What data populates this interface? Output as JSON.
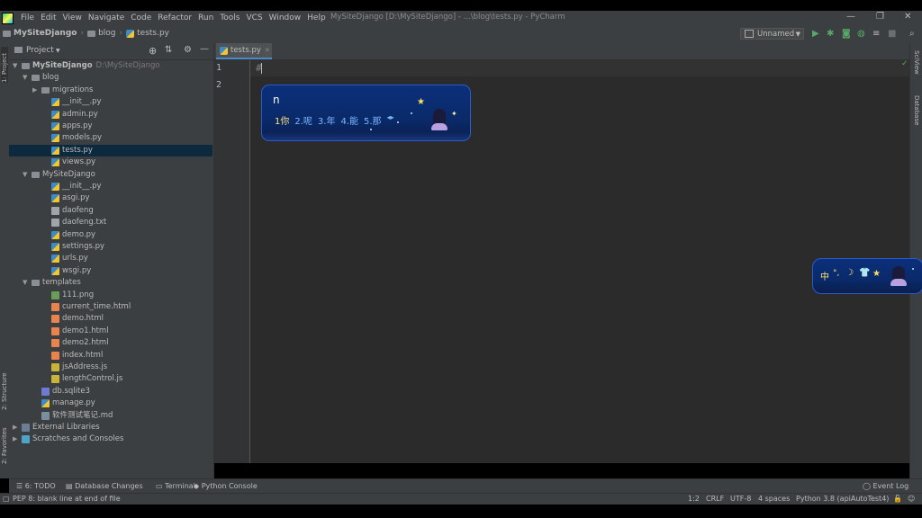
{
  "menu": {
    "items": [
      "File",
      "Edit",
      "View",
      "Navigate",
      "Code",
      "Refactor",
      "Run",
      "Tools",
      "VCS",
      "Window",
      "Help"
    ],
    "title": "MySiteDjango [D:\\MySiteDjango] - ...\\blog\\tests.py - PyCharm"
  },
  "nav": {
    "crumbs": [
      "MySiteDjango",
      "blog",
      "tests.py"
    ],
    "run_config": "Unnamed"
  },
  "project": {
    "header": "Project",
    "tree": [
      {
        "label": "MySiteDjango",
        "extra": "D:\\MySiteDjango",
        "icon": "folder",
        "arrow": "▼",
        "indent": 0,
        "bold": true
      },
      {
        "label": "blog",
        "icon": "folder",
        "arrow": "▼",
        "indent": 1
      },
      {
        "label": "migrations",
        "icon": "folder",
        "arrow": "▶",
        "indent": 2
      },
      {
        "label": "__init__.py",
        "icon": "py",
        "arrow": "",
        "indent": 3
      },
      {
        "label": "admin.py",
        "icon": "py",
        "arrow": "",
        "indent": 3
      },
      {
        "label": "apps.py",
        "icon": "py",
        "arrow": "",
        "indent": 3
      },
      {
        "label": "models.py",
        "icon": "py",
        "arrow": "",
        "indent": 3
      },
      {
        "label": "tests.py",
        "icon": "py",
        "arrow": "",
        "indent": 3,
        "selected": true
      },
      {
        "label": "views.py",
        "icon": "py",
        "arrow": "",
        "indent": 3
      },
      {
        "label": "MySiteDjango",
        "icon": "folder",
        "arrow": "▼",
        "indent": 1
      },
      {
        "label": "__init__.py",
        "icon": "py",
        "arrow": "",
        "indent": 3
      },
      {
        "label": "asgi.py",
        "icon": "py",
        "arrow": "",
        "indent": 3
      },
      {
        "label": "daofeng",
        "icon": "txt",
        "arrow": "",
        "indent": 3
      },
      {
        "label": "daofeng.txt",
        "icon": "txt",
        "arrow": "",
        "indent": 3
      },
      {
        "label": "demo.py",
        "icon": "py",
        "arrow": "",
        "indent": 3
      },
      {
        "label": "settings.py",
        "icon": "py",
        "arrow": "",
        "indent": 3
      },
      {
        "label": "urls.py",
        "icon": "py",
        "arrow": "",
        "indent": 3
      },
      {
        "label": "wsgi.py",
        "icon": "py",
        "arrow": "",
        "indent": 3
      },
      {
        "label": "templates",
        "icon": "folder",
        "arrow": "▼",
        "indent": 1
      },
      {
        "label": "111.png",
        "icon": "png",
        "arrow": "",
        "indent": 3
      },
      {
        "label": "current_time.html",
        "icon": "html",
        "arrow": "",
        "indent": 3
      },
      {
        "label": "demo.html",
        "icon": "html",
        "arrow": "",
        "indent": 3
      },
      {
        "label": "demo1.html",
        "icon": "html",
        "arrow": "",
        "indent": 3
      },
      {
        "label": "demo2.html",
        "icon": "html",
        "arrow": "",
        "indent": 3
      },
      {
        "label": "index.html",
        "icon": "html",
        "arrow": "",
        "indent": 3
      },
      {
        "label": "jsAddress.js",
        "icon": "js",
        "arrow": "",
        "indent": 3
      },
      {
        "label": "lengthControl.js",
        "icon": "js",
        "arrow": "",
        "indent": 3
      },
      {
        "label": "db.sqlite3",
        "icon": "db",
        "arrow": "",
        "indent": 2
      },
      {
        "label": "manage.py",
        "icon": "py",
        "arrow": "",
        "indent": 2
      },
      {
        "label": "软件测试笔记.md",
        "icon": "md",
        "arrow": "",
        "indent": 2
      },
      {
        "label": "External Libraries",
        "icon": "lib",
        "arrow": "▶",
        "indent": 0
      },
      {
        "label": "Scratches and Consoles",
        "icon": "scratch",
        "arrow": "▶",
        "indent": 0
      }
    ]
  },
  "editor": {
    "tab": "tests.py",
    "lines": [
      "1",
      "2"
    ],
    "code": "#"
  },
  "left_strip": {
    "project": "1: Project",
    "structure": "2: Structure",
    "favorites": "2: Favorites"
  },
  "right_strip": {
    "sciview": "SciView",
    "database": "Database"
  },
  "bottom_tools": {
    "todo": "6: TODO",
    "db_changes": "Database Changes",
    "terminal": "Terminal",
    "python_console": "Python Console",
    "event_log": "Event Log"
  },
  "status": {
    "message": "PEP 8: blank line at end of file",
    "position": "1:2",
    "line_sep": "CRLF",
    "encoding": "UTF-8",
    "indent": "4 spaces",
    "interpreter": "Python 3.8 (apiAutoTest4)"
  },
  "ime": {
    "input": "n",
    "candidates": [
      "1你",
      "2.呢",
      "3.年",
      "4.能",
      "5.那"
    ],
    "toolbar_label": "中"
  },
  "colors": {
    "bg": "#2b2b2b",
    "panel": "#3c3f41",
    "selection": "#0d293e",
    "accent": "#4a88c7",
    "ime": "#0b2f7a"
  }
}
